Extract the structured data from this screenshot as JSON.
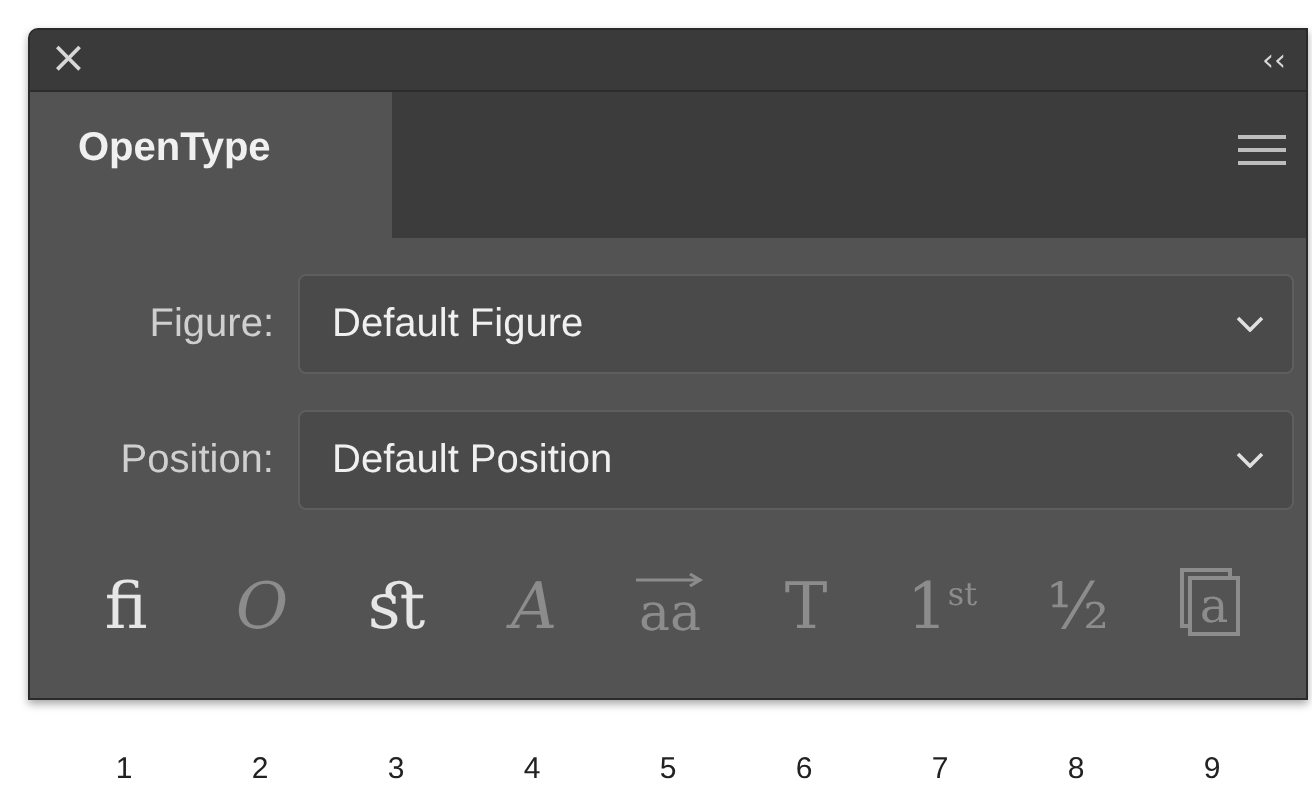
{
  "panel": {
    "close": "×",
    "collapse": "‹‹"
  },
  "tabs": [
    {
      "label": "OpenType",
      "selected": true
    }
  ],
  "fields": [
    {
      "label": "Figure:",
      "value": "Default Figure"
    },
    {
      "label": "Position:",
      "value": "Default Position"
    }
  ],
  "features": [
    {
      "kind": "glyph",
      "text": "ﬁ",
      "enabled": true
    },
    {
      "kind": "italic",
      "text": "O",
      "enabled": false
    },
    {
      "kind": "glyph",
      "text": "ﬆ",
      "enabled": true
    },
    {
      "kind": "italic",
      "text": "A",
      "enabled": false
    },
    {
      "kind": "arrow",
      "text": "aa",
      "enabled": false
    },
    {
      "kind": "glyph",
      "text": "T",
      "enabled": false
    },
    {
      "kind": "glyph",
      "text": "1$^{st}$",
      "enabled": false
    },
    {
      "kind": "glyph",
      "text": "½",
      "enabled": false
    },
    {
      "kind": "boxed",
      "text": "a",
      "enabled": false
    }
  ],
  "numbers": [
    "1",
    "2",
    "3",
    "4",
    "5",
    "6",
    "7",
    "8",
    "9"
  ]
}
